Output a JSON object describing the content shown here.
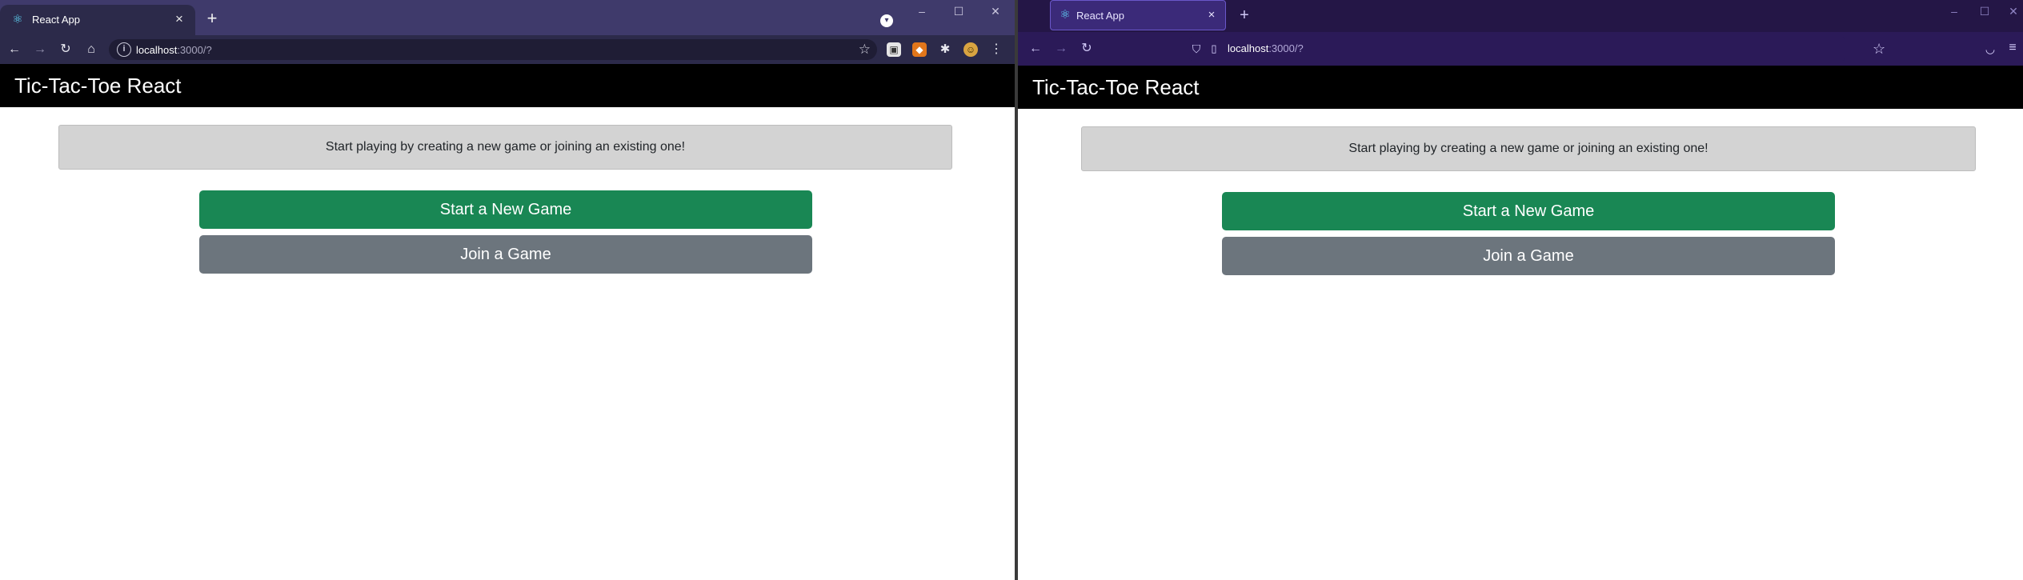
{
  "left_browser": {
    "tab_title": "React App",
    "url_host": "localhost",
    "url_path": ":3000/?"
  },
  "right_browser": {
    "tab_title": "React App",
    "url_host": "localhost",
    "url_path": ":3000/?"
  },
  "app": {
    "brand": "Tic-Tac-Toe React",
    "message": "Start playing by creating a new game or joining an existing one!",
    "new_game_label": "Start a New Game",
    "join_game_label": "Join a Game"
  },
  "colors": {
    "new_game_button": "#198754",
    "join_game_button": "#6c757d",
    "info_box": "#d3d3d3",
    "header": "#000000",
    "chrome_frame": "#3f3a6b",
    "firefox_frame": "#241646"
  },
  "icons": {
    "favicon": "react-icon",
    "back": "arrow-left-icon",
    "forward": "arrow-right-icon",
    "reload": "reload-icon",
    "home": "home-icon",
    "bookmark": "star-icon"
  }
}
